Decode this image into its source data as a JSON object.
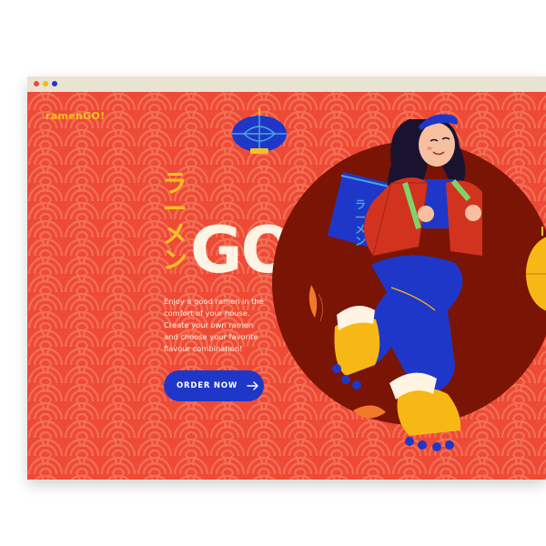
{
  "window": {
    "controls": [
      "close-dot",
      "minimize-dot",
      "maximize-dot"
    ]
  },
  "colors": {
    "background": "#ee4a35",
    "pattern_line": "#f78062",
    "logo": "#f9c021",
    "kana": "#f9c021",
    "headline": "#fff4e4",
    "button_bg": "#1f37c9",
    "button_text": "#ffffff",
    "circle": "#7a1404",
    "titlebar_red": "#ee4a35",
    "titlebar_yellow": "#f7b816",
    "titlebar_blue": "#1f37c9"
  },
  "header": {
    "logo": "ramenGO!"
  },
  "hero": {
    "kana": [
      "ラ",
      "ー",
      "メ",
      "ン"
    ],
    "headline": "GO!",
    "description": [
      "Enjoy a good ramen in the",
      "comfort of your house.",
      "Create your own ramen",
      "and choose your favorite",
      "flavour combination!"
    ],
    "cta_label": "ORDER NOW",
    "cta_icon": "arrow-right-icon"
  },
  "illustration": {
    "subject": "woman-on-roller-skates",
    "bag_text": [
      "ラ",
      "ー",
      "メ",
      "ン"
    ],
    "icons": [
      "lantern-icon",
      "lantern-icon-right"
    ]
  }
}
